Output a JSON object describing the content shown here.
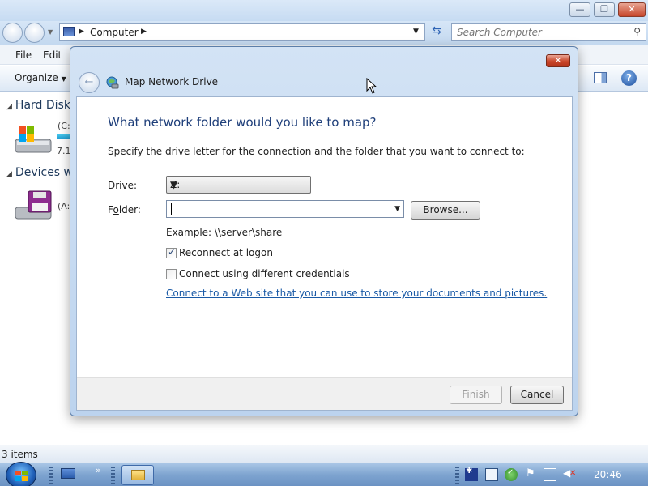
{
  "explorer": {
    "breadcrumb": "Computer",
    "search_placeholder": "Search Computer",
    "menu": {
      "file": "File",
      "edit": "Edit"
    },
    "organize": "Organize",
    "groups": [
      {
        "label": "Hard Disk"
      },
      {
        "label": "Devices w"
      }
    ],
    "drives": [
      {
        "label": "(C:",
        "sub": "7.1"
      },
      {
        "label": "(A:"
      }
    ],
    "status": "3 items"
  },
  "taskbar": {
    "clock": "20:46"
  },
  "dialog": {
    "title": "Map Network Drive",
    "close_glyph": "✕",
    "heading": "What network folder would you like to map?",
    "description": "Specify the drive letter for the connection and the folder that you want to connect to:",
    "drive_label_pre": "",
    "drive_label_key": "D",
    "drive_label_post": "rive:",
    "drive_value": "Z:",
    "folder_label_pre": "F",
    "folder_label_key": "o",
    "folder_label_post": "lder:",
    "folder_value": "",
    "browse_label": "Browse...",
    "example": "Example: \\\\server\\share",
    "reconnect": {
      "label": "Reconnect at logon",
      "checked": true
    },
    "credentials": {
      "label": "Connect using different credentials",
      "checked": false
    },
    "link": "Connect to a Web site that you can use to store your documents and pictures",
    "link_suffix": ".",
    "finish_label": "Finish",
    "cancel_label": "Cancel"
  },
  "colors": {
    "heading": "#1f3f7a",
    "link": "#1a5aa6",
    "dialog_frame": "#bcd3ee",
    "close_button": "#c9462a"
  }
}
